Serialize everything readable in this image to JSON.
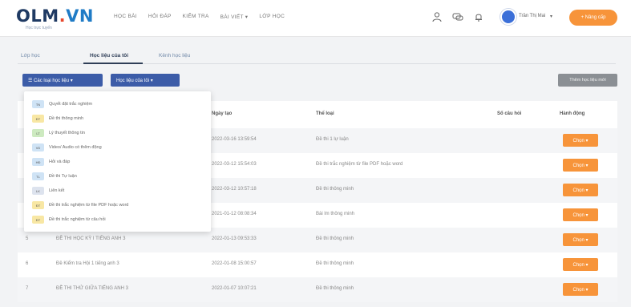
{
  "header": {
    "logo_text": "OLM",
    "logo_dot": ".",
    "logo_vn": "VN",
    "logo_tagline": "Học trực tuyến",
    "nav": [
      "Học bài",
      "Hỏi đáp",
      "Kiểm tra",
      "Bài viết",
      "Lớp học"
    ],
    "nav_caret": "▾",
    "username": "Trần Thị Mai",
    "upgrade_label": "+ Nâng cấp"
  },
  "tabs": [
    "Lớp học",
    "Học liệu của tôi",
    "Kênh học liệu"
  ],
  "toolbar": {
    "type_filter": "☰ Các loại học liệu ▾",
    "my_filter": "Học liệu của tôi ▾",
    "gray_button": "Thêm học liệu mới"
  },
  "table": {
    "headers": [
      "Ngày tạo",
      "Thể loại",
      "Số câu hỏi",
      "Hành động"
    ],
    "rows": [
      {
        "num": "",
        "name": "",
        "date": "2022-03-16 13:59:54",
        "type": "Đề thi 1 lự luận",
        "action": "Chọn ▾"
      },
      {
        "num": "",
        "name": "",
        "date": "2022-03-12 15:54:03",
        "type": "Đề thi trắc nghiệm từ file PDF hoặc word",
        "action": "Chọn ▾"
      },
      {
        "num": "",
        "name": "",
        "date": "2022-03-12 10:57:18",
        "type": "Đề thi thông minh",
        "action": "Chọn ▾"
      },
      {
        "num": "",
        "name": "",
        "date": "2021-01-12 08:08:34",
        "type": "Bài lm thông minh",
        "action": "Chọn ▾"
      },
      {
        "num": "5",
        "name": "ĐỀ THI HỌC KỲ I TIẾNG ANH 3",
        "date": "2022-01-13 09:53:33",
        "type": "Đề thi thông minh",
        "action": "Chọn ▾"
      },
      {
        "num": "6",
        "name": "Đề Kiểm tra Hội 1 tiếng anh 3",
        "date": "2022-01-08 15:00:57",
        "type": "Đề thi thông minh",
        "action": "Chọn ▾"
      },
      {
        "num": "7",
        "name": "ĐỀ THI THỬ GIỮA TIẾNG ANH 3",
        "date": "2022-01-07 10:07:21",
        "type": "Đề thi thông minh",
        "action": "Chọn ▾"
      }
    ]
  },
  "dropdown": [
    {
      "badge": "TN",
      "label": "Quyết đặt trắc nghiệm",
      "color": "#cfe3f5"
    },
    {
      "badge": "ĐT",
      "label": "Đề thi thông minh",
      "color": "#f8e7a4"
    },
    {
      "badge": "LT",
      "label": "Lý thuyết thông tin",
      "color": "#cdeac0"
    },
    {
      "badge": "VD",
      "label": "Video/ Audio có thêm động",
      "color": "#cfe3f5"
    },
    {
      "badge": "HĐ",
      "label": "Hỏi và đáp",
      "color": "#cfe3f5"
    },
    {
      "badge": "TL",
      "label": "Đề thi Tự luận",
      "color": "#cfe3f5"
    },
    {
      "badge": "LK",
      "label": "Liên kết",
      "color": "#dde3ee"
    },
    {
      "badge": "ĐT",
      "label": "Đề thi trắc nghiệm từ file PDF hoặc word",
      "color": "#f8e7a4"
    },
    {
      "badge": "ĐT",
      "label": "Đề thi trắc nghiệm từ câu hỏi",
      "color": "#f8e7a4"
    }
  ],
  "colors": {
    "brand_blue": "#3c5ca8",
    "accent_orange": "#f7943a"
  }
}
